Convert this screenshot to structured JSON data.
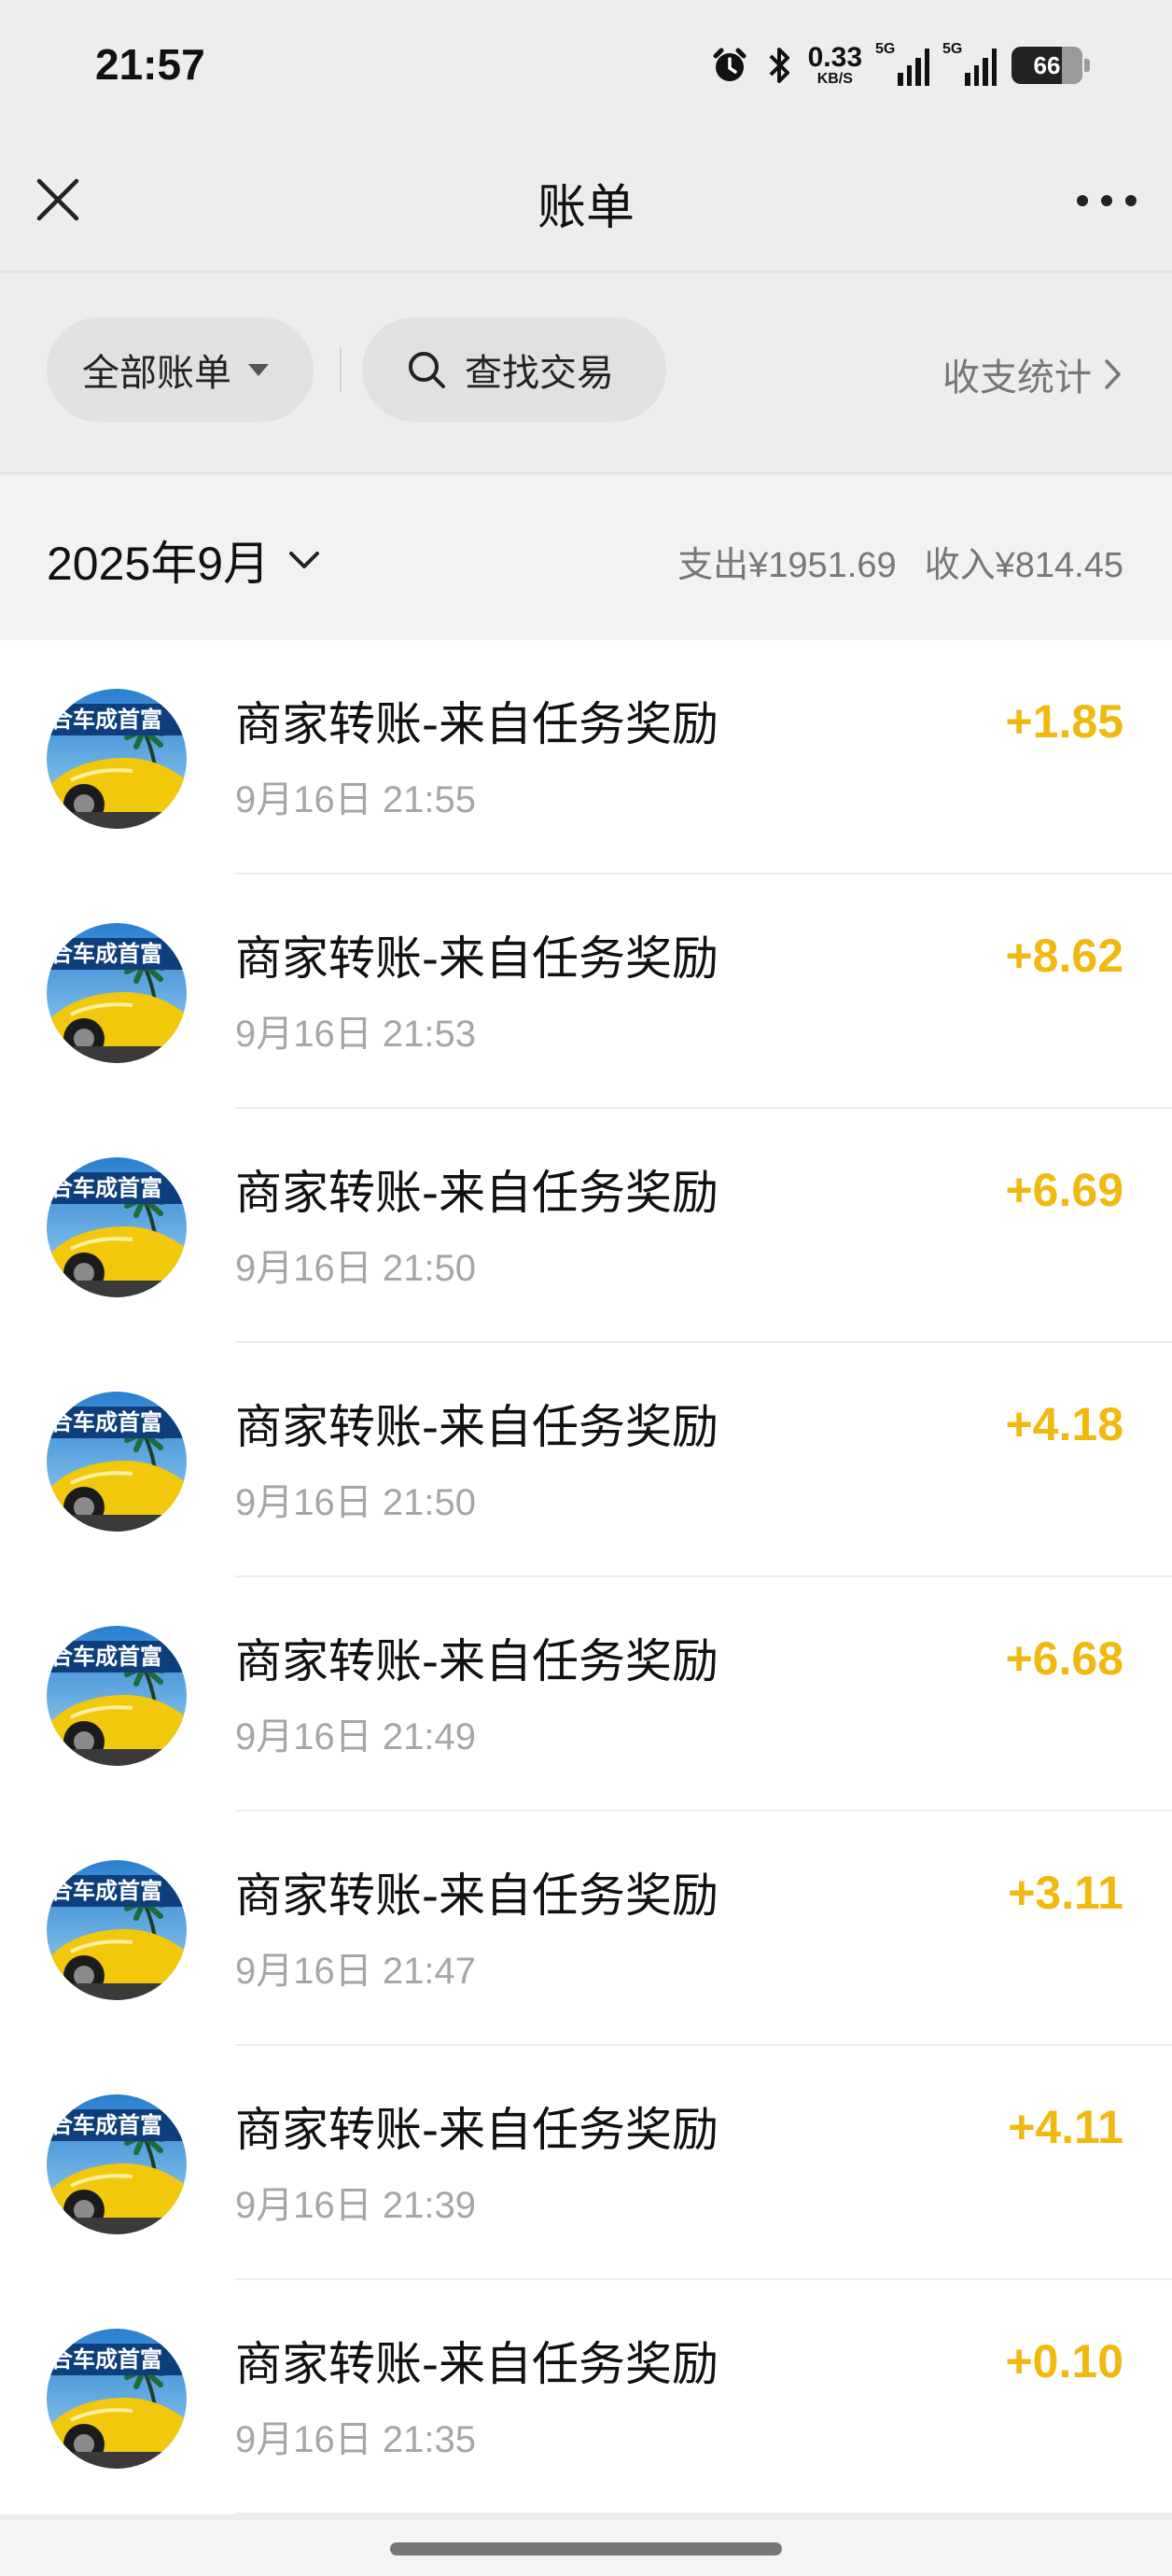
{
  "status": {
    "time": "21:57",
    "net_speed_value": "0.33",
    "net_speed_unit": "KB/S",
    "signal1_label": "5G",
    "signal2_label": "5G",
    "battery": "66"
  },
  "header": {
    "title": "账单",
    "close_icon": "close-icon",
    "more_icon": "more-dots-icon"
  },
  "filters": {
    "all_bills": "全部账单",
    "search": "查找交易",
    "stats": "收支统计"
  },
  "month": {
    "label": "2025年9月",
    "expense": "支出¥1951.69",
    "income": "收入¥814.45"
  },
  "transactions": [
    {
      "title": "商家转账-来自任务奖励",
      "time": "9月16日 21:55",
      "amount": "+1.85"
    },
    {
      "title": "商家转账-来自任务奖励",
      "time": "9月16日 21:53",
      "amount": "+8.62"
    },
    {
      "title": "商家转账-来自任务奖励",
      "time": "9月16日 21:50",
      "amount": "+6.69"
    },
    {
      "title": "商家转账-来自任务奖励",
      "time": "9月16日 21:50",
      "amount": "+4.18"
    },
    {
      "title": "商家转账-来自任务奖励",
      "time": "9月16日 21:49",
      "amount": "+6.68"
    },
    {
      "title": "商家转账-来自任务奖励",
      "time": "9月16日 21:47",
      "amount": "+3.11"
    },
    {
      "title": "商家转账-来自任务奖励",
      "time": "9月16日 21:39",
      "amount": "+4.11"
    },
    {
      "title": "商家转账-来自任务奖励",
      "time": "9月16日 21:35",
      "amount": "+0.10"
    }
  ],
  "avatar_banner_text": "合车成首富",
  "colors": {
    "income_amount": "#f1b90f",
    "background": "#ededed"
  }
}
